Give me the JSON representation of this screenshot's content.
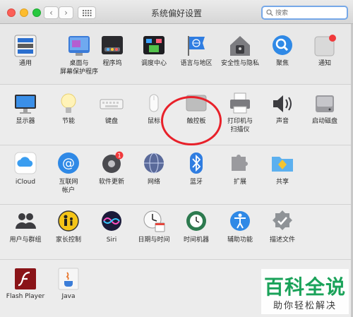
{
  "window": {
    "title": "系统偏好设置"
  },
  "toolbar": {
    "back_glyph": "‹",
    "forward_glyph": "›"
  },
  "search": {
    "placeholder": "搜索",
    "value": ""
  },
  "row1": [
    {
      "label": "通用",
      "icon": "general-icon"
    },
    {
      "label": "桌面与\n屏幕保护程序",
      "icon": "desktop-screensaver-icon"
    },
    {
      "label": "程序坞",
      "icon": "dock-icon"
    },
    {
      "label": "调度中心",
      "icon": "mission-control-icon"
    },
    {
      "label": "语言与地区",
      "icon": "language-region-icon"
    },
    {
      "label": "安全性与隐私",
      "icon": "security-privacy-icon"
    },
    {
      "label": "聚焦",
      "icon": "spotlight-icon"
    },
    {
      "label": "通知",
      "icon": "notifications-icon"
    }
  ],
  "row2": [
    {
      "label": "显示器",
      "icon": "displays-icon"
    },
    {
      "label": "节能",
      "icon": "energy-saver-icon"
    },
    {
      "label": "键盘",
      "icon": "keyboard-icon"
    },
    {
      "label": "鼠标",
      "icon": "mouse-icon"
    },
    {
      "label": "触控板",
      "icon": "trackpad-icon"
    },
    {
      "label": "打印机与\n扫描仪",
      "icon": "printers-scanners-icon"
    },
    {
      "label": "声音",
      "icon": "sound-icon"
    },
    {
      "label": "启动磁盘",
      "icon": "startup-disk-icon"
    }
  ],
  "row3": [
    {
      "label": "iCloud",
      "icon": "icloud-icon"
    },
    {
      "label": "互联网\n帐户",
      "icon": "internet-accounts-icon"
    },
    {
      "label": "软件更新",
      "icon": "software-update-icon",
      "badge": "1"
    },
    {
      "label": "网络",
      "icon": "network-icon"
    },
    {
      "label": "蓝牙",
      "icon": "bluetooth-icon"
    },
    {
      "label": "扩展",
      "icon": "extensions-icon"
    },
    {
      "label": "共享",
      "icon": "sharing-icon"
    }
  ],
  "row4": [
    {
      "label": "用户与群组",
      "icon": "users-groups-icon"
    },
    {
      "label": "家长控制",
      "icon": "parental-controls-icon"
    },
    {
      "label": "Siri",
      "icon": "siri-icon"
    },
    {
      "label": "日期与时间",
      "icon": "date-time-icon"
    },
    {
      "label": "时间机器",
      "icon": "time-machine-icon"
    },
    {
      "label": "辅助功能",
      "icon": "accessibility-icon"
    },
    {
      "label": "描述文件",
      "icon": "profiles-icon"
    }
  ],
  "row5": [
    {
      "label": "Flash Player",
      "icon": "flash-player-icon"
    },
    {
      "label": "Java",
      "icon": "java-icon"
    }
  ],
  "watermark": {
    "title": "百科全说",
    "subtitle": "助你轻松解决"
  },
  "colors": {
    "highlight_ring": "#e8212a",
    "watermark_green": "#1aa259",
    "search_focus": "#76a8e8"
  }
}
